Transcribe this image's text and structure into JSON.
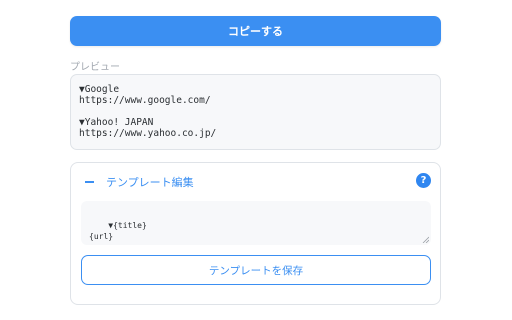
{
  "copy_button": {
    "label": "コピーする"
  },
  "preview": {
    "label": "プレビュー",
    "content": "▼Google\nhttps://www.google.com/\n\n▼Yahoo! JAPAN\nhttps://www.yahoo.co.jp/"
  },
  "template_editor": {
    "collapse_icon": "minus-icon",
    "title": "テンプレート編集",
    "help_icon": "question-icon",
    "help_glyph": "?",
    "template_text": "▼{title}\n{url}",
    "save_label": "テンプレートを保存"
  },
  "colors": {
    "accent": "#3b8ff2",
    "border": "#dfe3e8",
    "muted_text": "#a2a8b0",
    "field_background": "#f7f8fa"
  }
}
